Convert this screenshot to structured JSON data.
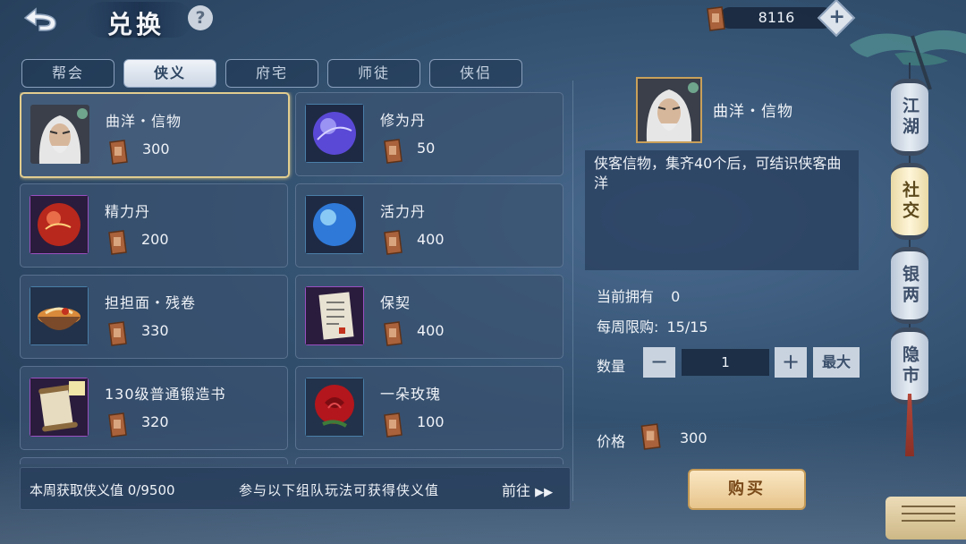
{
  "header": {
    "title": "兑换",
    "help_label": "?",
    "currency_amount": "8116"
  },
  "tabs": [
    {
      "label": "帮会",
      "active": false
    },
    {
      "label": "侠义",
      "active": true
    },
    {
      "label": "府宅",
      "active": false
    },
    {
      "label": "师徒",
      "active": false
    },
    {
      "label": "侠侣",
      "active": false
    }
  ],
  "items": [
    {
      "name": "曲洋・信物",
      "price": "300",
      "icon": "portrait-icon",
      "selected": true
    },
    {
      "name": "修为丹",
      "price": "50",
      "icon": "purple-orb-icon"
    },
    {
      "name": "精力丹",
      "price": "200",
      "icon": "red-orb-icon"
    },
    {
      "name": "活力丹",
      "price": "400",
      "icon": "blue-orb-icon"
    },
    {
      "name": "担担面・残卷",
      "price": "330",
      "icon": "noodle-bowl-icon"
    },
    {
      "name": "保契",
      "price": "400",
      "icon": "paper-contract-icon"
    },
    {
      "name": "130级普通锻造书",
      "price": "320",
      "icon": "scroll-book-icon"
    },
    {
      "name": "一朵玫瑰",
      "price": "100",
      "icon": "rose-icon"
    }
  ],
  "bottom_strip": {
    "weekly": "本周获取侠义值 0/9500",
    "hint": "参与以下组队玩法可获得侠义值",
    "goto": "前往"
  },
  "detail": {
    "name": "曲洋・信物",
    "description": "侠客信物，集齐40个后，可结识侠客曲洋",
    "owned_label": "当前拥有",
    "owned_value": "0",
    "limit_label": "每周限购:",
    "limit_value": "15/15",
    "qty_label": "数量",
    "qty_minus": "−",
    "qty_value": "1",
    "qty_plus": "+",
    "qty_max": "最大",
    "price_label": "价格",
    "price_value": "300",
    "buy_label": "购买"
  },
  "side_nav": [
    {
      "label": "江湖",
      "active": false
    },
    {
      "label": "社交",
      "active": true
    },
    {
      "label": "银两",
      "active": false
    },
    {
      "label": "隐市",
      "active": false
    }
  ]
}
